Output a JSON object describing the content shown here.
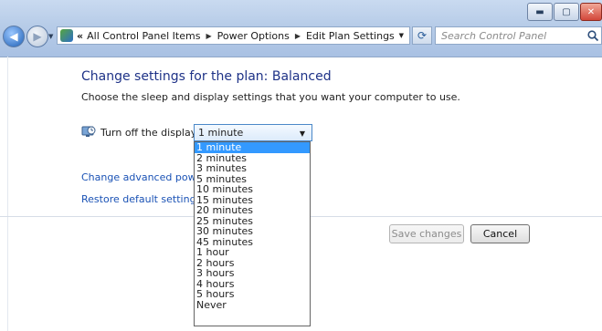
{
  "window": {
    "buttons": {
      "minimize": "▬",
      "maximize": "▢",
      "close": "✕"
    }
  },
  "nav": {
    "breadcrumbs": [
      "All Control Panel Items",
      "Power Options",
      "Edit Plan Settings"
    ],
    "overflow_marker": "«",
    "search_placeholder": "Search Control Panel"
  },
  "page": {
    "title": "Change settings for the plan: Balanced",
    "subtitle": "Choose the sleep and display settings that you want your computer to use.",
    "display_setting": {
      "label": "Turn off the display:",
      "selected": "1 minute",
      "options": [
        "1 minute",
        "2 minutes",
        "3 minutes",
        "5 minutes",
        "10 minutes",
        "15 minutes",
        "20 minutes",
        "25 minutes",
        "30 minutes",
        "45 minutes",
        "1 hour",
        "2 hours",
        "3 hours",
        "4 hours",
        "5 hours",
        "Never"
      ]
    },
    "links": {
      "advanced": "Change advanced power se",
      "restore": "Restore default settings for t"
    },
    "buttons": {
      "save": "Save changes",
      "cancel": "Cancel"
    }
  },
  "colors": {
    "heading": "#1e3287",
    "link": "#1a52b5",
    "selection": "#3399ff"
  }
}
